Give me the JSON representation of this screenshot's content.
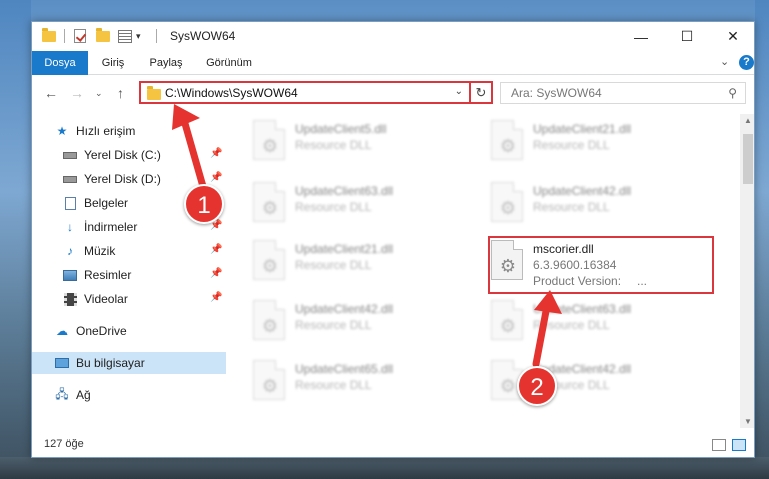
{
  "titlebar": {
    "title": "SysWOW64",
    "minimize": "—",
    "maximize": "☐",
    "close": "✕"
  },
  "ribbon": {
    "tabs": [
      {
        "label": "Dosya"
      },
      {
        "label": "Giriş"
      },
      {
        "label": "Paylaş"
      },
      {
        "label": "Görünüm"
      }
    ],
    "collapse": "⌄",
    "help": "?"
  },
  "address": {
    "path": "C:\\Windows\\SysWOW64",
    "dropdown": "⌄",
    "refresh": "↻"
  },
  "search": {
    "placeholder": "Ara: SysWOW64"
  },
  "nav": {
    "items": [
      {
        "label": "Hızlı erişim"
      },
      {
        "label": "Yerel Disk (C:)"
      },
      {
        "label": "Yerel Disk (D:)"
      },
      {
        "label": "Belgeler"
      },
      {
        "label": "İndirmeler"
      },
      {
        "label": "Müzik"
      },
      {
        "label": "Resimler"
      },
      {
        "label": "Videolar"
      },
      {
        "label": "OneDrive"
      },
      {
        "label": "Bu bilgisayar"
      },
      {
        "label": "Ağ"
      }
    ]
  },
  "files": {
    "left": [
      {
        "name": "UpdateClient5.dll",
        "type": "Resource DLL"
      },
      {
        "name": "UpdateClient63.dll",
        "type": "Resource DLL"
      },
      {
        "name": "UpdateClient21.dll",
        "type": "Resource DLL"
      },
      {
        "name": "UpdateClient42.dll",
        "type": "Resource DLL"
      },
      {
        "name": "UpdateClient65.dll",
        "type": "Resource DLL"
      }
    ],
    "right": [
      {
        "name": "UpdateClient21.dll",
        "type": "Resource DLL"
      },
      {
        "name": "UpdateClient42.dll",
        "type": "Resource DLL"
      },
      {
        "name": "UpdateClient63.dll",
        "type": "Resource DLL"
      },
      {
        "name": "UpdateClient42.dll",
        "type": "Resource DLL"
      }
    ],
    "highlighted": {
      "name": "mscorier.dll",
      "version": "6.3.9600.16384",
      "product_label": "Product Version:",
      "product_value": "..."
    }
  },
  "status": {
    "count": "127 öğe"
  },
  "annotations": {
    "step1": "1",
    "step2": "2"
  },
  "colors": {
    "accent": "#1979ca",
    "highlight": "#d9363e",
    "badge": "#e5342f"
  }
}
